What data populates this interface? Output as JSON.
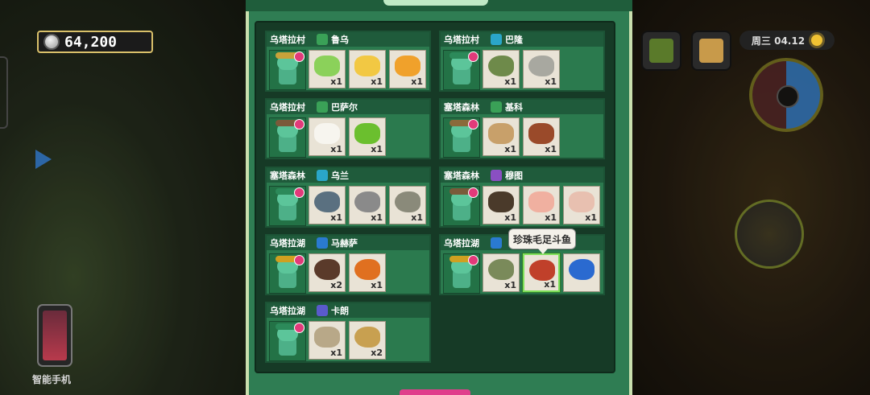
{
  "hud": {
    "currency_value": "64,200",
    "phone_label": "智能手机",
    "date": "周三 04.12"
  },
  "tooltip": "珍珠毛足斗鱼",
  "cards": [
    {
      "location": "乌塔拉村",
      "npc": "鲁乌",
      "npc_color": "#3aa157",
      "hat_color": "#c8a23a",
      "items": [
        {
          "name": "lime",
          "qty": "x1",
          "color": "#8bd15a"
        },
        {
          "name": "banana",
          "qty": "x1",
          "color": "#f2c843"
        },
        {
          "name": "carambola",
          "qty": "x1",
          "color": "#f0a12b"
        }
      ]
    },
    {
      "location": "乌塔拉村",
      "npc": "巴隆",
      "npc_color": "#2aa6c9",
      "hat_color": "#2c8a5a",
      "items": [
        {
          "name": "tilapia",
          "qty": "x1",
          "color": "#6e8a4a"
        },
        {
          "name": "catfish",
          "qty": "x1",
          "color": "#a8a8a0"
        }
      ]
    },
    {
      "location": "乌塔拉村",
      "npc": "巴萨尔",
      "npc_color": "#3aa157",
      "hat_color": "#7a5a3a",
      "items": [
        {
          "name": "egg",
          "qty": "x1",
          "color": "#f7f5ef"
        },
        {
          "name": "fiddlehead",
          "qty": "x1",
          "color": "#6bbf2e"
        }
      ]
    },
    {
      "location": "塞塔森林",
      "npc": "基科",
      "npc_color": "#3aa157",
      "hat_color": "#8a6a3a",
      "items": [
        {
          "name": "log",
          "qty": "x1",
          "color": "#c8a06a"
        },
        {
          "name": "wood",
          "qty": "x1",
          "color": "#9a4a2a"
        }
      ]
    },
    {
      "location": "塞塔森林",
      "npc": "乌兰",
      "npc_color": "#2aa6c9",
      "hat_color": "#2c8a5a",
      "items": [
        {
          "name": "fish-a",
          "qty": "x1",
          "color": "#5a7080"
        },
        {
          "name": "fish-b",
          "qty": "x1",
          "color": "#8a8a8a"
        },
        {
          "name": "fish-c",
          "qty": "x1",
          "color": "#8a8a7a"
        }
      ]
    },
    {
      "location": "塞塔森林",
      "npc": "穆图",
      "npc_color": "#8a4fc2",
      "hat_color": "#7a5a3a",
      "items": [
        {
          "name": "eel",
          "qty": "x1",
          "color": "#4a3a2a"
        },
        {
          "name": "shrimp",
          "qty": "x1",
          "color": "#f0b0a0"
        },
        {
          "name": "root",
          "qty": "x1",
          "color": "#e8c0b0"
        }
      ]
    },
    {
      "location": "乌塔拉湖",
      "npc": "马赫萨",
      "npc_color": "#2a7ad0",
      "hat_color": "#d0a020",
      "items": [
        {
          "name": "crayfish",
          "qty": "x2",
          "color": "#5a3a2a"
        },
        {
          "name": "goldfish",
          "qty": "x1",
          "color": "#e07020"
        }
      ]
    },
    {
      "location": "乌塔拉湖",
      "npc": "",
      "npc_color": "#2a7ad0",
      "hat_color": "#d0a020",
      "items": [
        {
          "name": "bass",
          "qty": "x1",
          "color": "#7a8a5a"
        },
        {
          "name": "pearl-gourami",
          "qty": "x1",
          "color": "#c0402a",
          "selected": true
        },
        {
          "name": "betta",
          "qty": "",
          "color": "#2a6ad0"
        }
      ]
    },
    {
      "location": "乌塔拉湖",
      "npc": "卡朗",
      "npc_color": "#5a5acb",
      "hat_color": "#2c8a5a",
      "items": [
        {
          "name": "ammonite",
          "qty": "x1",
          "color": "#b8a888"
        },
        {
          "name": "arowana",
          "qty": "x2",
          "color": "#c8a050"
        }
      ]
    }
  ]
}
